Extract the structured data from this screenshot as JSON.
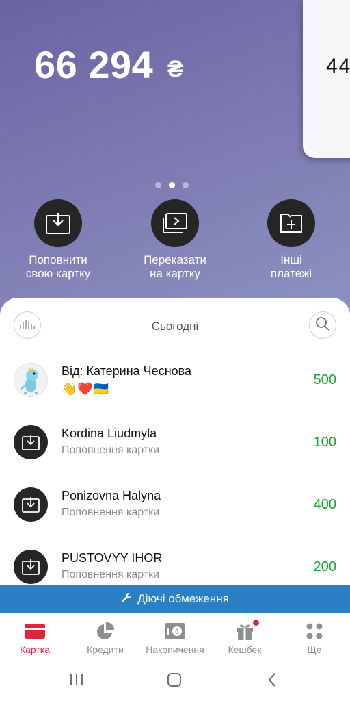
{
  "balance": {
    "amount": "66 294",
    "currency": "₴"
  },
  "next_card": {
    "partial_text": "44"
  },
  "pager": {
    "count": 3,
    "active_index": 1
  },
  "actions": [
    {
      "line1": "Поповнити",
      "line2": "свою картку",
      "icon": "download-icon"
    },
    {
      "line1": "Переказати",
      "line2": "на картку",
      "icon": "card-transfer-icon"
    },
    {
      "line1": "Інші",
      "line2": "платежі",
      "icon": "folder-plus-icon"
    }
  ],
  "history": {
    "day_label": "Сьогодні",
    "stats_icon": "chart-bars-icon",
    "search_icon": "search-icon",
    "transactions": [
      {
        "name": "Від: Катерина Чеснова",
        "emoji": [
          "👋",
          "❤️",
          "🇺🇦"
        ],
        "amount": "500",
        "avatar": "dino-avatar"
      },
      {
        "name": "Kordina Liudmyla",
        "subtitle": "Поповнення картки",
        "amount": "100",
        "avatar": "download-icon"
      },
      {
        "name": "Ponizovna Halyna",
        "subtitle": "Поповнення картки",
        "amount": "400",
        "avatar": "download-icon"
      },
      {
        "name": "PUSTOVYY IHOR",
        "subtitle": "Поповнення картки",
        "amount": "200",
        "avatar": "download-icon"
      }
    ]
  },
  "limits_banner": {
    "label": "Діючі обмеження",
    "icon": "wrench-icon"
  },
  "tabs": [
    {
      "label": "Картка",
      "icon": "card-icon",
      "active": true
    },
    {
      "label": "Кредити",
      "icon": "pie-chart-icon",
      "active": false
    },
    {
      "label": "Накопичення",
      "icon": "savings-box-icon",
      "active": false
    },
    {
      "label": "Кешбек",
      "icon": "gift-icon",
      "active": false,
      "badge": true
    },
    {
      "label": "Ще",
      "icon": "grid-dots-icon",
      "active": false
    }
  ],
  "colors": {
    "accent": "#e0253b",
    "positive": "#17a62a",
    "banner": "#2b7fc4",
    "dark": "#262626"
  }
}
